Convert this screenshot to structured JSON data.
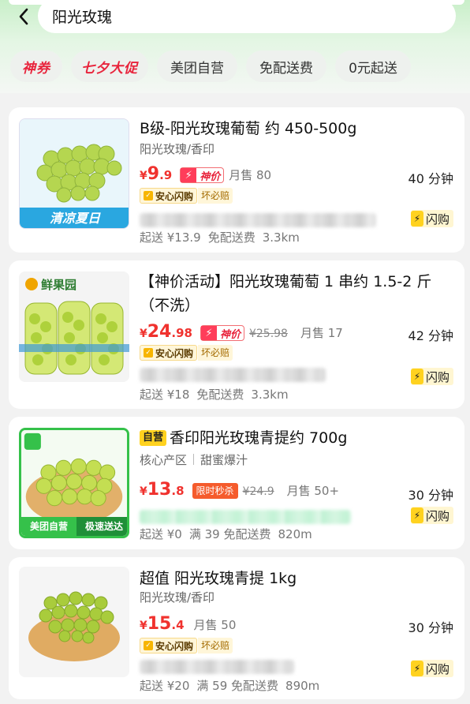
{
  "search": {
    "query": "阳光玫瑰"
  },
  "chips": [
    {
      "label": "神券",
      "hot": true
    },
    {
      "label": "七夕大促",
      "hot": true
    },
    {
      "label": "美团自营",
      "hot": false
    },
    {
      "label": "免配送费",
      "hot": false
    },
    {
      "label": "0元起送",
      "hot": false
    }
  ],
  "products": [
    {
      "title": "B级-阳光玫瑰葡萄 约 450-500g",
      "subtitle": "阳光玫瑰/香印",
      "yen": "¥",
      "price_int": "9",
      "price_dec": ".9",
      "badge_godprice": "神价",
      "sales": "月售 80",
      "anxin": "安心闪购",
      "huai": "坏必赔",
      "delivery": [
        "起送 ¥13.9",
        "免配送费",
        "3.3km"
      ],
      "eta": "40 分钟",
      "flash": "闪购",
      "thumb_caption": "清凉夏日"
    },
    {
      "title": "【神价活动】阳光玫瑰葡萄 1 串约 1.5-2 斤（不洗）",
      "yen": "¥",
      "price_int": "24",
      "price_dec": ".98",
      "badge_godprice": "神价",
      "old_price": "¥25.98",
      "sales": "月售 17",
      "anxin": "安心闪购",
      "huai": "坏必赔",
      "delivery": [
        "起送 ¥18",
        "免配送费",
        "3.3km"
      ],
      "eta": "42 分钟",
      "flash": "闪购",
      "thumb_brand": "鲜果园"
    },
    {
      "tag": "自营",
      "title": "香印阳光玫瑰青提约 700g",
      "subtitle_parts": [
        "核心产区",
        "甜蜜爆汁"
      ],
      "yen": "¥",
      "price_int": "13",
      "price_dec": ".8",
      "badge_flash": "限时秒杀",
      "old_price": "¥24.9",
      "sales": "月售 50+",
      "delivery": [
        "起送 ¥0",
        "满 39 免配送费",
        "820m"
      ],
      "eta": "30 分钟",
      "flash": "闪购",
      "thumb_left": "美团自营",
      "thumb_right": "极速送达"
    },
    {
      "title": "超值 阳光玫瑰青提 1kg",
      "subtitle": "阳光玫瑰/香印",
      "yen": "¥",
      "price_int": "15",
      "price_dec": ".4",
      "sales": "月售 50",
      "anxin": "安心闪购",
      "huai": "坏必赔",
      "delivery": [
        "起送 ¥20",
        "满 59 免配送费",
        "890m"
      ],
      "eta": "30 分钟",
      "flash": "闪购"
    }
  ],
  "colors": {
    "price": "#f0322e",
    "accent_green": "#c9efc9",
    "flash_yellow": "#ffd21f"
  }
}
